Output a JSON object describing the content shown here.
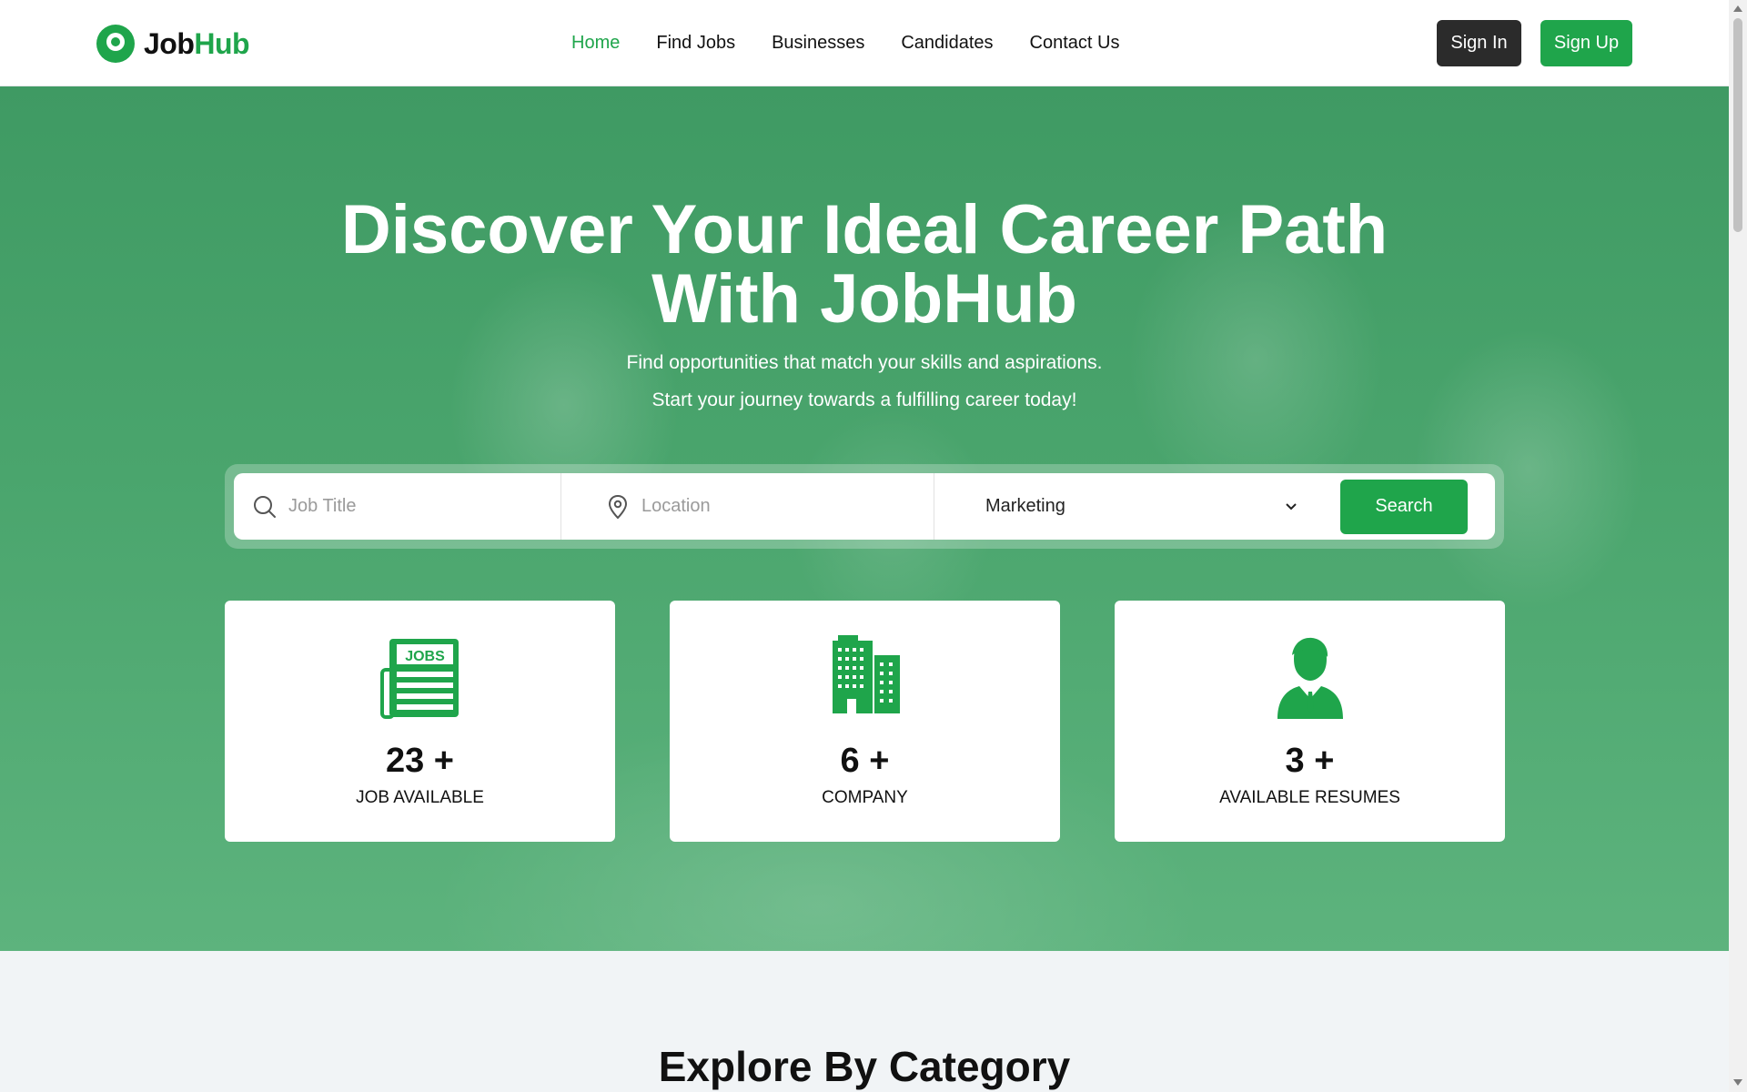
{
  "brand": {
    "part1": "Job",
    "part2": "Hub",
    "color": "#1fa54b"
  },
  "nav": {
    "items": [
      {
        "label": "Home",
        "active": true
      },
      {
        "label": "Find Jobs"
      },
      {
        "label": "Businesses"
      },
      {
        "label": "Candidates"
      },
      {
        "label": "Contact Us"
      }
    ]
  },
  "auth": {
    "signin": "Sign In",
    "signup": "Sign Up"
  },
  "hero": {
    "title_line1": "Discover Your Ideal Career Path",
    "title_line2": "With JobHub",
    "subtitle1": "Find opportunities that match your skills and aspirations.",
    "subtitle2": "Start your journey towards a fulfilling career today!"
  },
  "search": {
    "job_title_placeholder": "Job Title",
    "location_placeholder": "Location",
    "category_selected": "Marketing",
    "button": "Search"
  },
  "stats": [
    {
      "icon": "jobs-newspaper-icon",
      "icon_text": "JOBS",
      "value": "23 +",
      "label": "JOB AVAILABLE"
    },
    {
      "icon": "buildings-icon",
      "value": "6 +",
      "label": "COMPANY"
    },
    {
      "icon": "person-icon",
      "value": "3 +",
      "label": "AVAILABLE RESUMES"
    }
  ],
  "explore": {
    "title": "Explore By Category"
  },
  "colors": {
    "accent": "#1fa54b",
    "dark_button": "#2b2b2b"
  }
}
